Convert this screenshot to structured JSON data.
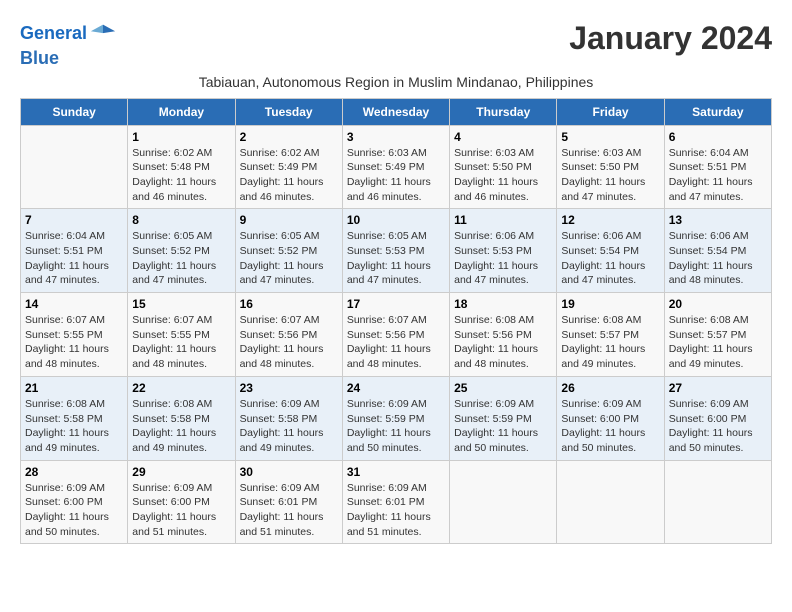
{
  "logo": {
    "line1": "General",
    "line2": "Blue"
  },
  "title": "January 2024",
  "subtitle": "Tabiauan, Autonomous Region in Muslim Mindanao, Philippines",
  "days_of_week": [
    "Sunday",
    "Monday",
    "Tuesday",
    "Wednesday",
    "Thursday",
    "Friday",
    "Saturday"
  ],
  "weeks": [
    [
      {
        "day": "",
        "info": ""
      },
      {
        "day": "1",
        "info": "Sunrise: 6:02 AM\nSunset: 5:48 PM\nDaylight: 11 hours and 46 minutes."
      },
      {
        "day": "2",
        "info": "Sunrise: 6:02 AM\nSunset: 5:49 PM\nDaylight: 11 hours and 46 minutes."
      },
      {
        "day": "3",
        "info": "Sunrise: 6:03 AM\nSunset: 5:49 PM\nDaylight: 11 hours and 46 minutes."
      },
      {
        "day": "4",
        "info": "Sunrise: 6:03 AM\nSunset: 5:50 PM\nDaylight: 11 hours and 46 minutes."
      },
      {
        "day": "5",
        "info": "Sunrise: 6:03 AM\nSunset: 5:50 PM\nDaylight: 11 hours and 47 minutes."
      },
      {
        "day": "6",
        "info": "Sunrise: 6:04 AM\nSunset: 5:51 PM\nDaylight: 11 hours and 47 minutes."
      }
    ],
    [
      {
        "day": "7",
        "info": "Sunrise: 6:04 AM\nSunset: 5:51 PM\nDaylight: 11 hours and 47 minutes."
      },
      {
        "day": "8",
        "info": "Sunrise: 6:05 AM\nSunset: 5:52 PM\nDaylight: 11 hours and 47 minutes."
      },
      {
        "day": "9",
        "info": "Sunrise: 6:05 AM\nSunset: 5:52 PM\nDaylight: 11 hours and 47 minutes."
      },
      {
        "day": "10",
        "info": "Sunrise: 6:05 AM\nSunset: 5:53 PM\nDaylight: 11 hours and 47 minutes."
      },
      {
        "day": "11",
        "info": "Sunrise: 6:06 AM\nSunset: 5:53 PM\nDaylight: 11 hours and 47 minutes."
      },
      {
        "day": "12",
        "info": "Sunrise: 6:06 AM\nSunset: 5:54 PM\nDaylight: 11 hours and 47 minutes."
      },
      {
        "day": "13",
        "info": "Sunrise: 6:06 AM\nSunset: 5:54 PM\nDaylight: 11 hours and 48 minutes."
      }
    ],
    [
      {
        "day": "14",
        "info": "Sunrise: 6:07 AM\nSunset: 5:55 PM\nDaylight: 11 hours and 48 minutes."
      },
      {
        "day": "15",
        "info": "Sunrise: 6:07 AM\nSunset: 5:55 PM\nDaylight: 11 hours and 48 minutes."
      },
      {
        "day": "16",
        "info": "Sunrise: 6:07 AM\nSunset: 5:56 PM\nDaylight: 11 hours and 48 minutes."
      },
      {
        "day": "17",
        "info": "Sunrise: 6:07 AM\nSunset: 5:56 PM\nDaylight: 11 hours and 48 minutes."
      },
      {
        "day": "18",
        "info": "Sunrise: 6:08 AM\nSunset: 5:56 PM\nDaylight: 11 hours and 48 minutes."
      },
      {
        "day": "19",
        "info": "Sunrise: 6:08 AM\nSunset: 5:57 PM\nDaylight: 11 hours and 49 minutes."
      },
      {
        "day": "20",
        "info": "Sunrise: 6:08 AM\nSunset: 5:57 PM\nDaylight: 11 hours and 49 minutes."
      }
    ],
    [
      {
        "day": "21",
        "info": "Sunrise: 6:08 AM\nSunset: 5:58 PM\nDaylight: 11 hours and 49 minutes."
      },
      {
        "day": "22",
        "info": "Sunrise: 6:08 AM\nSunset: 5:58 PM\nDaylight: 11 hours and 49 minutes."
      },
      {
        "day": "23",
        "info": "Sunrise: 6:09 AM\nSunset: 5:58 PM\nDaylight: 11 hours and 49 minutes."
      },
      {
        "day": "24",
        "info": "Sunrise: 6:09 AM\nSunset: 5:59 PM\nDaylight: 11 hours and 50 minutes."
      },
      {
        "day": "25",
        "info": "Sunrise: 6:09 AM\nSunset: 5:59 PM\nDaylight: 11 hours and 50 minutes."
      },
      {
        "day": "26",
        "info": "Sunrise: 6:09 AM\nSunset: 6:00 PM\nDaylight: 11 hours and 50 minutes."
      },
      {
        "day": "27",
        "info": "Sunrise: 6:09 AM\nSunset: 6:00 PM\nDaylight: 11 hours and 50 minutes."
      }
    ],
    [
      {
        "day": "28",
        "info": "Sunrise: 6:09 AM\nSunset: 6:00 PM\nDaylight: 11 hours and 50 minutes."
      },
      {
        "day": "29",
        "info": "Sunrise: 6:09 AM\nSunset: 6:00 PM\nDaylight: 11 hours and 51 minutes."
      },
      {
        "day": "30",
        "info": "Sunrise: 6:09 AM\nSunset: 6:01 PM\nDaylight: 11 hours and 51 minutes."
      },
      {
        "day": "31",
        "info": "Sunrise: 6:09 AM\nSunset: 6:01 PM\nDaylight: 11 hours and 51 minutes."
      },
      {
        "day": "",
        "info": ""
      },
      {
        "day": "",
        "info": ""
      },
      {
        "day": "",
        "info": ""
      }
    ]
  ]
}
